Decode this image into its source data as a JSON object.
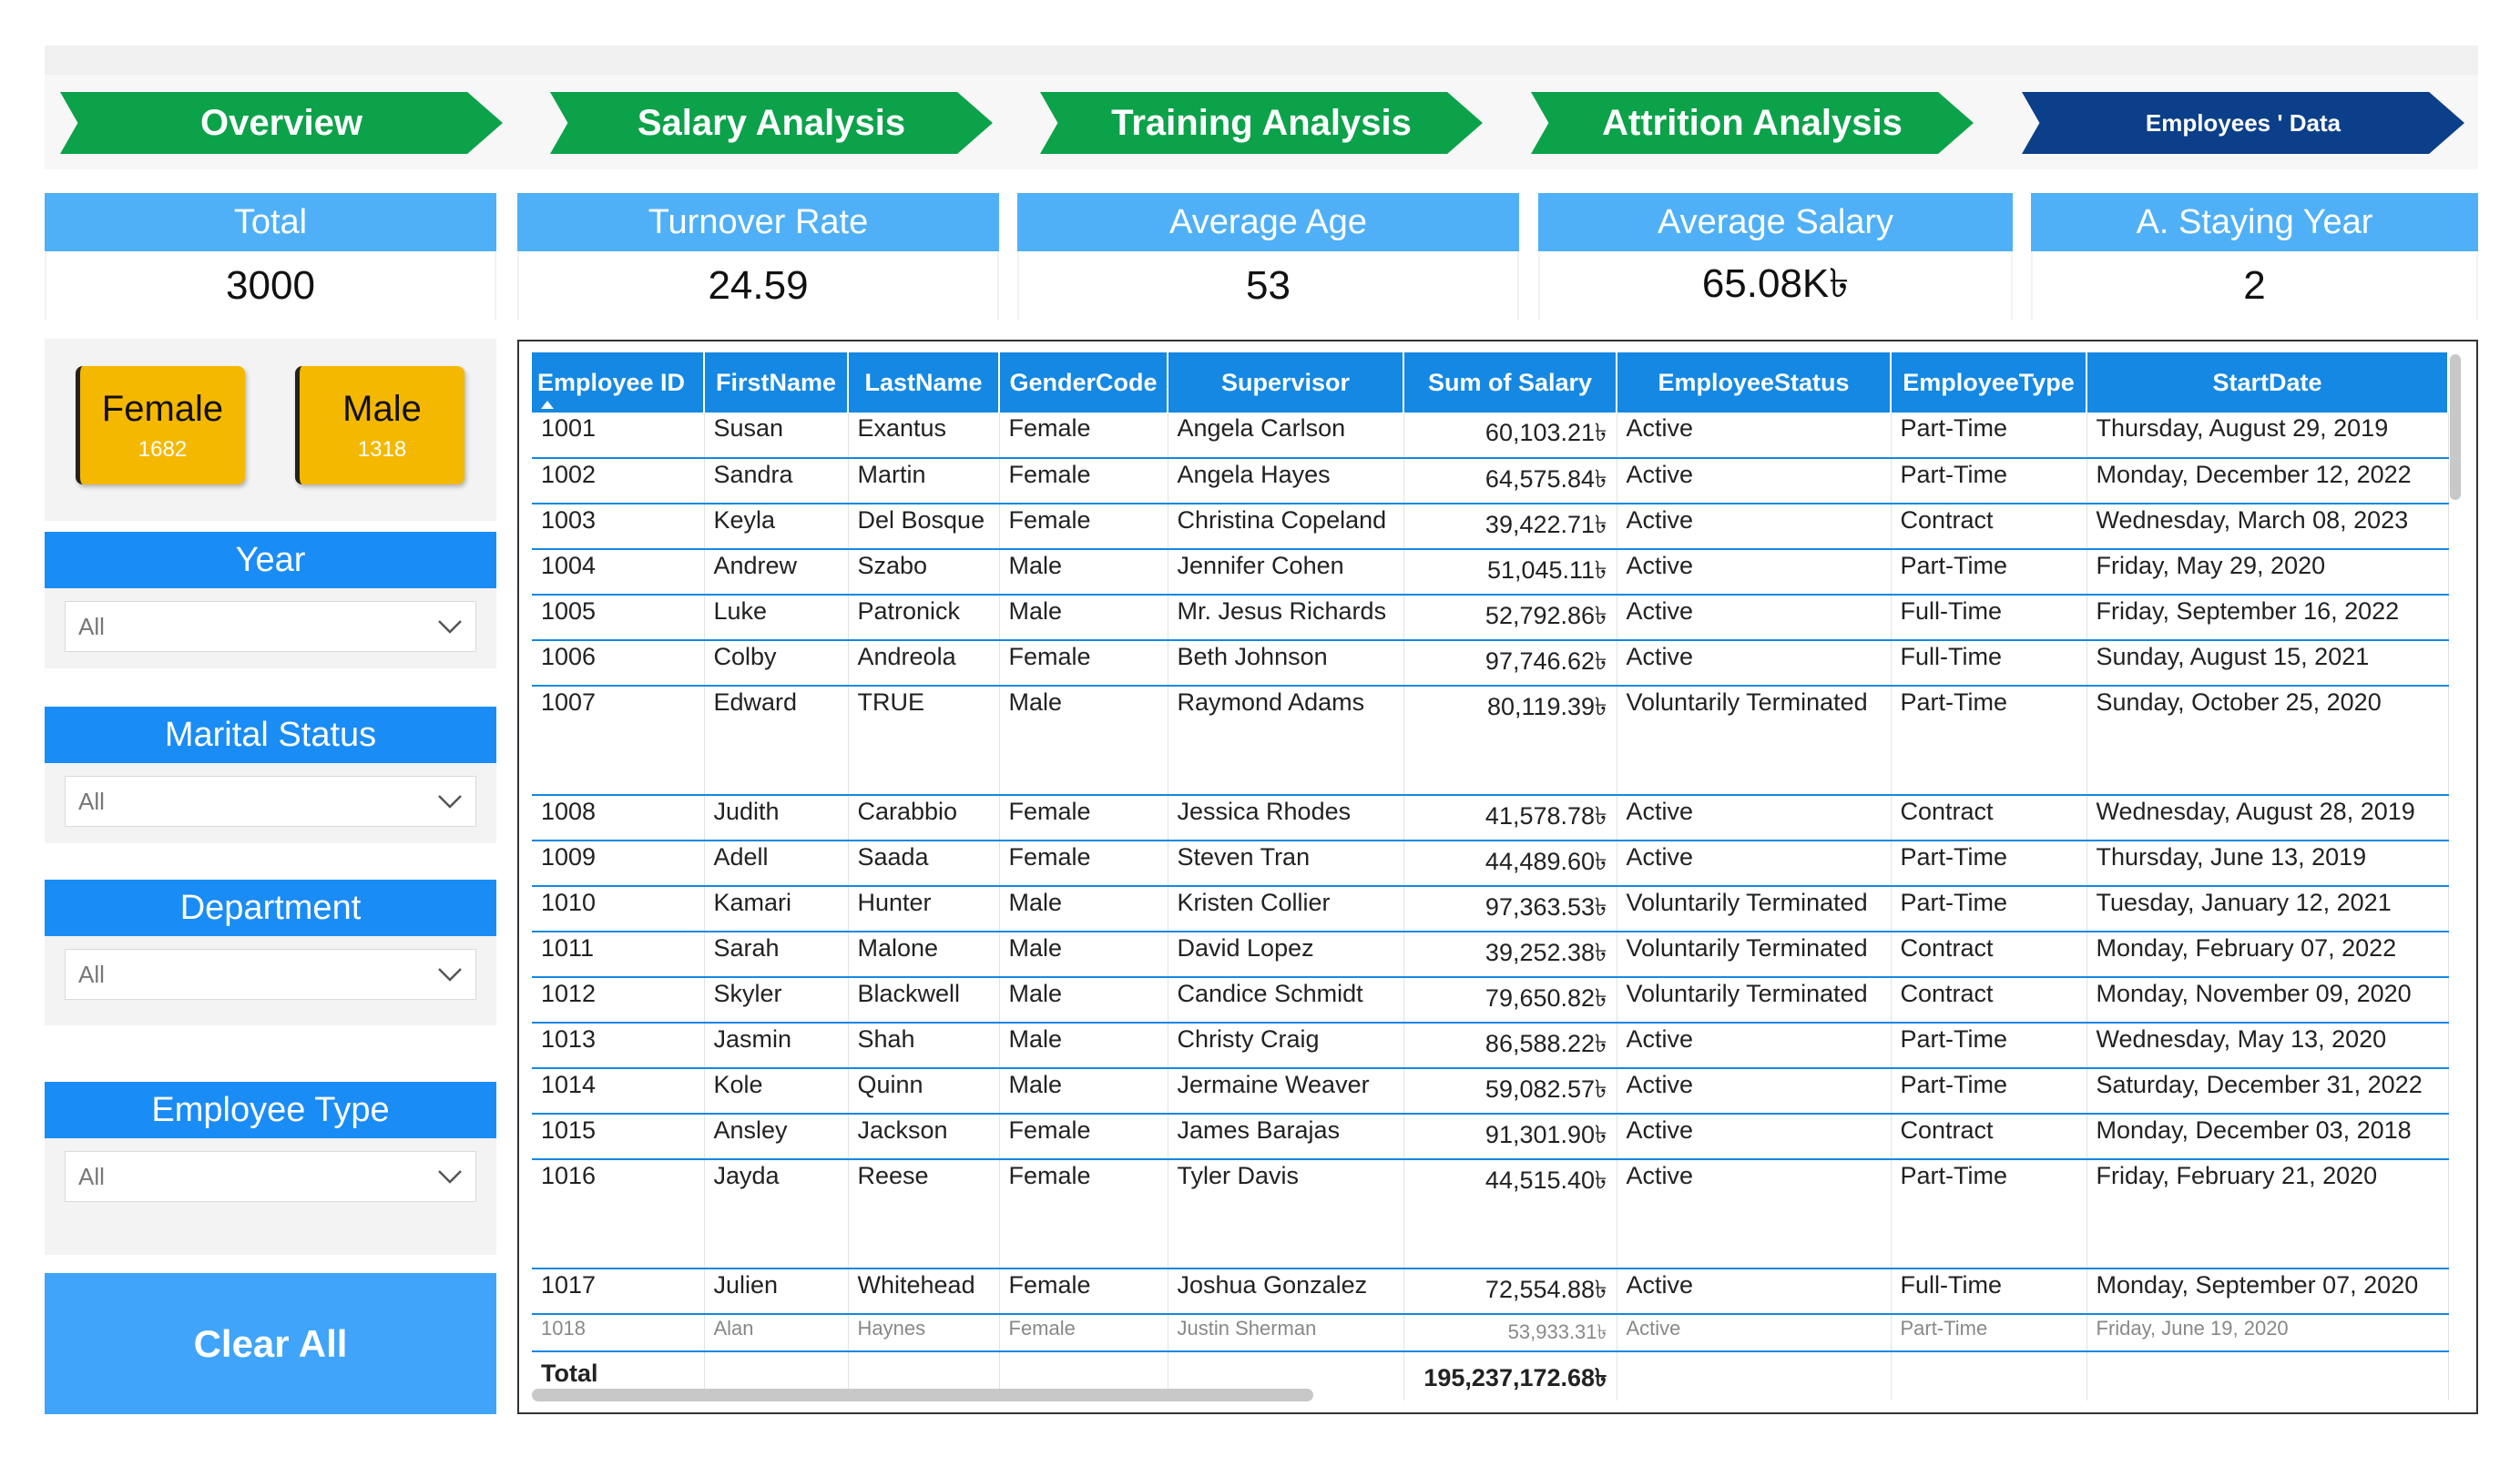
{
  "nav": {
    "overview": "Overview",
    "salary": "Salary Analysis",
    "training": "Training Analysis",
    "attrition": "Attrition Analysis",
    "employees": "Employees ' Data"
  },
  "kpis": {
    "total": {
      "label": "Total",
      "value": "3000"
    },
    "turnover": {
      "label": "Turnover Rate",
      "value": "24.59"
    },
    "age": {
      "label": "Average Age",
      "value": "53"
    },
    "salary": {
      "label": "Average Salary",
      "value": "65.08K৳"
    },
    "staying": {
      "label": "A. Staying Year",
      "value": "2"
    }
  },
  "gender": {
    "female": {
      "label": "Female",
      "count": "1682"
    },
    "male": {
      "label": "Male",
      "count": "1318"
    }
  },
  "slicers": {
    "year": {
      "label": "Year",
      "value": "All"
    },
    "marital": {
      "label": "Marital Status",
      "value": "All"
    },
    "department": {
      "label": "Department",
      "value": "All"
    },
    "emptype": {
      "label": "Employee Type",
      "value": "All"
    }
  },
  "clear_all": "Clear All",
  "table": {
    "columns": [
      "Employee ID",
      "FirstName",
      "LastName",
      "GenderCode",
      "Supervisor",
      "Sum of Salary",
      "EmployeeStatus",
      "EmployeeType",
      "StartDate"
    ],
    "rows": [
      [
        "1001",
        "Susan",
        "Exantus",
        "Female",
        "Angela Carlson",
        "60,103.21৳",
        "Active",
        "Part-Time",
        "Thursday, August 29, 2019"
      ],
      [
        "1002",
        "Sandra",
        "Martin",
        "Female",
        "Angela Hayes",
        "64,575.84৳",
        "Active",
        "Part-Time",
        "Monday, December 12, 2022"
      ],
      [
        "1003",
        "Keyla",
        "Del Bosque",
        "Female",
        "Christina Copeland",
        "39,422.71৳",
        "Active",
        "Contract",
        "Wednesday, March 08, 2023"
      ],
      [
        "1004",
        "Andrew",
        "Szabo",
        "Male",
        "Jennifer Cohen",
        "51,045.11৳",
        "Active",
        "Part-Time",
        "Friday, May 29, 2020"
      ],
      [
        "1005",
        "Luke",
        "Patronick",
        "Male",
        "Mr. Jesus Richards",
        "52,792.86৳",
        "Active",
        "Full-Time",
        "Friday, September 16, 2022"
      ],
      [
        "1006",
        "Colby",
        "Andreola",
        "Female",
        "Beth Johnson",
        "97,746.62৳",
        "Active",
        "Full-Time",
        "Sunday, August 15, 2021"
      ],
      [
        "1007",
        "Edward",
        "TRUE",
        "Male",
        "Raymond Adams",
        "80,119.39৳",
        "Voluntarily Terminated",
        "Part-Time",
        "Sunday, October 25, 2020"
      ],
      [
        "1008",
        "Judith",
        "Carabbio",
        "Female",
        "Jessica Rhodes",
        "41,578.78৳",
        "Active",
        "Contract",
        "Wednesday, August 28, 2019"
      ],
      [
        "1009",
        "Adell",
        "Saada",
        "Female",
        "Steven Tran",
        "44,489.60৳",
        "Active",
        "Part-Time",
        "Thursday, June 13, 2019"
      ],
      [
        "1010",
        "Kamari",
        "Hunter",
        "Male",
        "Kristen Collier",
        "97,363.53৳",
        "Voluntarily Terminated",
        "Part-Time",
        "Tuesday, January 12, 2021"
      ],
      [
        "1011",
        "Sarah",
        "Malone",
        "Male",
        "David Lopez",
        "39,252.38৳",
        "Voluntarily Terminated",
        "Contract",
        "Monday, February 07, 2022"
      ],
      [
        "1012",
        "Skyler",
        "Blackwell",
        "Male",
        "Candice Schmidt",
        "79,650.82৳",
        "Voluntarily Terminated",
        "Contract",
        "Monday, November 09, 2020"
      ],
      [
        "1013",
        "Jasmin",
        "Shah",
        "Male",
        "Christy Craig",
        "86,588.22৳",
        "Active",
        "Part-Time",
        "Wednesday, May 13, 2020"
      ],
      [
        "1014",
        "Kole",
        "Quinn",
        "Male",
        "Jermaine Weaver",
        "59,082.57৳",
        "Active",
        "Part-Time",
        "Saturday, December 31, 2022"
      ],
      [
        "1015",
        "Ansley",
        "Jackson",
        "Female",
        "James Barajas",
        "91,301.90৳",
        "Active",
        "Contract",
        "Monday, December 03, 2018"
      ],
      [
        "1016",
        "Jayda",
        "Reese",
        "Female",
        "Tyler Davis",
        "44,515.40৳",
        "Active",
        "Part-Time",
        "Friday, February 21, 2020"
      ],
      [
        "1017",
        "Julien",
        "Whitehead",
        "Female",
        "Joshua Gonzalez",
        "72,554.88৳",
        "Active",
        "Full-Time",
        "Monday, September 07, 2020"
      ],
      [
        "1018",
        "Alan",
        "Haynes",
        "Female",
        "Justin Sherman",
        "53,933.31৳",
        "Active",
        "Part-Time",
        "Friday, June 19, 2020"
      ]
    ],
    "total_label": "Total",
    "total_salary": "195,237,172.68৳"
  }
}
